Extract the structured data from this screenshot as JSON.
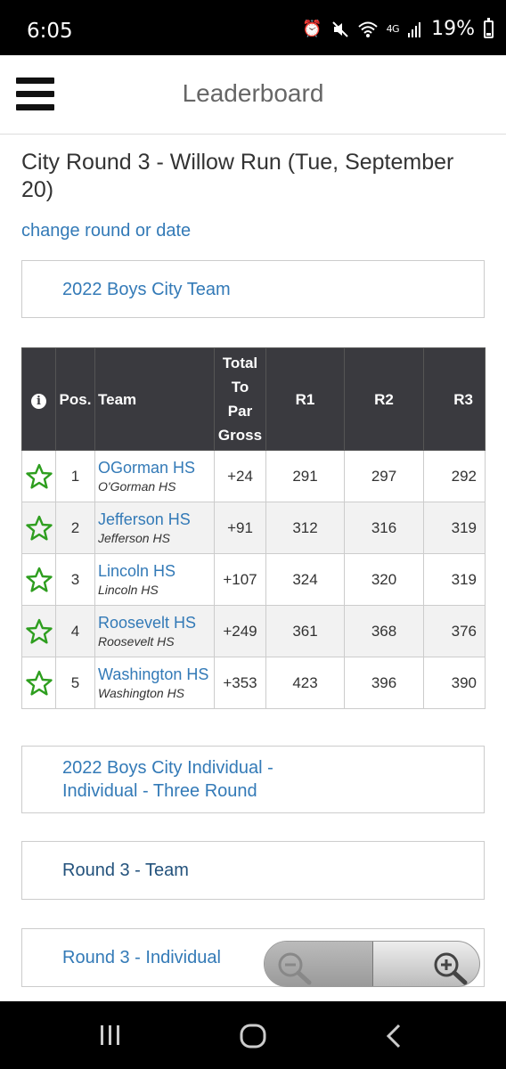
{
  "status_bar": {
    "time": "6:05",
    "network": "4G",
    "battery": "19%",
    "icons": [
      "alarm-icon",
      "mute-icon",
      "wifi-icon",
      "signal-icon",
      "battery-icon"
    ]
  },
  "header": {
    "title": "Leaderboard",
    "menu_icon": "hamburger-menu-icon"
  },
  "page": {
    "title": "City Round 3 - Willow Run (Tue, September 20)",
    "change_link": "change round or date"
  },
  "panels": {
    "team": "2022 Boys City Team",
    "individual": "2022 Boys City Individual - Individual - Three Round",
    "round_team": "Round 3 - Team",
    "round_individual": "Round 3 - Individual"
  },
  "table": {
    "headers": {
      "info": "i",
      "pos": "Pos.",
      "team": "Team",
      "total": [
        "Total",
        "To",
        "Par",
        "Gross"
      ],
      "r1": "R1",
      "r2": "R2",
      "r3": "R3"
    },
    "rows": [
      {
        "pos": "1",
        "team": "OGorman HS",
        "school": "O'Gorman HS",
        "total": "+24",
        "r1": "291",
        "r2": "297",
        "r3": "292"
      },
      {
        "pos": "2",
        "team": "Jefferson HS",
        "school": "Jefferson HS",
        "total": "+91",
        "r1": "312",
        "r2": "316",
        "r3": "319"
      },
      {
        "pos": "3",
        "team": "Lincoln HS",
        "school": "Lincoln HS",
        "total": "+107",
        "r1": "324",
        "r2": "320",
        "r3": "319"
      },
      {
        "pos": "4",
        "team": "Roosevelt HS",
        "school": "Roosevelt HS",
        "total": "+249",
        "r1": "361",
        "r2": "368",
        "r3": "376"
      },
      {
        "pos": "5",
        "team": "Washington HS",
        "school": "Washington HS",
        "total": "+353",
        "r1": "423",
        "r2": "396",
        "r3": "390"
      }
    ]
  },
  "colors": {
    "link": "#337ab7",
    "header_bg": "#3a3a3f",
    "star": "#2e9e1f"
  }
}
